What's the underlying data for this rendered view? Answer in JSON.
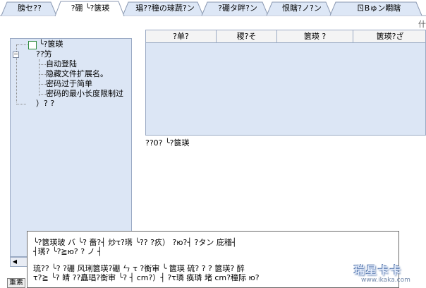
{
  "tabs": [
    {
      "label": "膀セ??",
      "active": false
    },
    {
      "label": "?硼 ╰?篋瑛",
      "active": true
    },
    {
      "label": "琩??穜の琜蔬?ン",
      "active": false
    },
    {
      "label": "?硼タ眫?ン",
      "active": false
    },
    {
      "label": "恨瞎?ノ?ン",
      "active": false
    },
    {
      "label": "ㄖΒゅン瞷瞎",
      "active": false
    }
  ],
  "top_right_text": "什",
  "tree": {
    "root_label": "╰?篋瑛",
    "group_label": "??竻",
    "items": [
      "自动登陆",
      "隐藏文件扩展名。",
      "密码过于简单",
      "密码的最小长度限制过"
    ],
    "trailing_label": "）?  ?"
  },
  "grid": {
    "columns": [
      "?单?",
      "稷?そ",
      "篋瑛  ?",
      "篋瑛?ざ"
    ],
    "caption": "??0? ╰?篋瑛"
  },
  "description": {
    "lines": [
      "   ╰?篋瑛玻  バ   ╰?      嗇?┤   炒τ?璓   ╰??   ?疚）     ?ю?┤   ?タン   庇稽┤",
      "┤璓? ╰?≧ю?     ?    ノ          ┤",
      "",
      "   琉??  ╰?   ?硼   风琍篋瑛?硼  ㄣ       τ     ?衡审 ╰       篋瑛   硫?  ?   ?   篋瑛?  醉",
      "τ?≧ ╰?  皘       ??矗琩?衡审  ╰?       ┤   cm?）┤   ?τ璘   痪璘  堵   cm?穜际   ю?"
    ]
  },
  "bottom_button_label": "重素",
  "watermark": {
    "text": "瑞星卡卡",
    "url": "www.ikaka.com"
  }
}
